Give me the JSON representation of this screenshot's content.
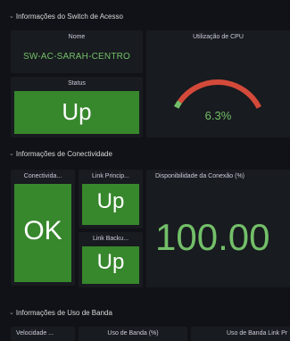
{
  "switch_section": {
    "title": "Informações do Switch de Acesso",
    "nome": {
      "title": "Nome",
      "value": "SW-AC-SARAH-CENTRO"
    },
    "status": {
      "title": "Status",
      "value": "Up"
    },
    "cpu": {
      "title": "Utilização de CPU",
      "value": "6.3%",
      "fraction": 0.063
    }
  },
  "connectivity_section": {
    "title": "Informações de Conectividade",
    "conectividade": {
      "title": "Conectivida...",
      "value": "OK"
    },
    "link_principal": {
      "title": "Link Princip...",
      "value": "Up"
    },
    "link_backup": {
      "title": "Link Backu...",
      "value": "Up"
    },
    "disponibilidade": {
      "title": "Disponibilidade da Conexão (%)",
      "value": "100.00"
    }
  },
  "bandwidth_section": {
    "title": "Informações de Uso de Banda",
    "panels": [
      {
        "title": "Velocidade ..."
      },
      {
        "title": "Uso de Banda (%)"
      },
      {
        "title": "Uso de Banda Link Pr"
      }
    ]
  },
  "colors": {
    "background": "#111217",
    "panel": "#181b1f",
    "ok_green": "#37872d",
    "value_green": "#73bf69",
    "gauge_red": "#d44a3a"
  }
}
